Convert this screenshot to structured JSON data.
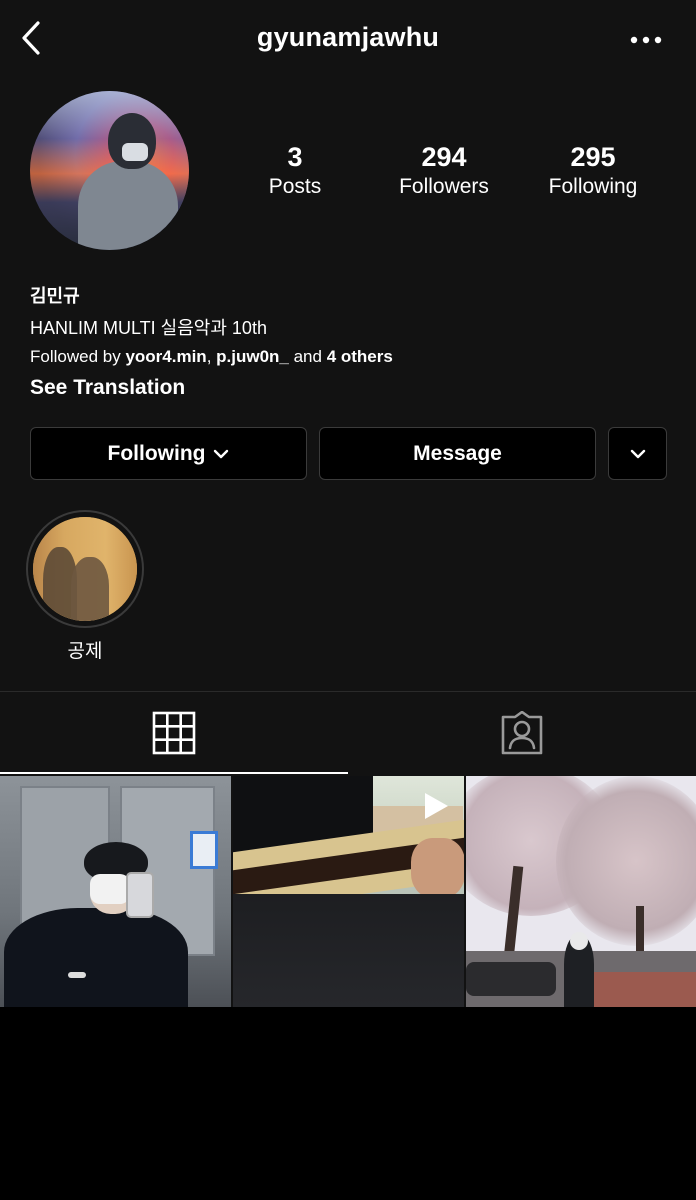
{
  "header": {
    "username": "gyunamjawhu",
    "back_icon": "chevron-left-icon",
    "more_icon": "more-horizontal-icon"
  },
  "stats": [
    {
      "value": "3",
      "label": "Posts"
    },
    {
      "value": "294",
      "label": "Followers"
    },
    {
      "value": "295",
      "label": "Following"
    }
  ],
  "bio": {
    "name": "김민규",
    "line": "HANLIM MULTI 실음악과 10th",
    "followed_by_prefix": "Followed by ",
    "follower1": "yoor4.min",
    "comma": ", ",
    "follower2": "p.juw0n_",
    "and": " and ",
    "others": "4 others",
    "see_translation": "See Translation"
  },
  "actions": {
    "following": "Following",
    "message": "Message"
  },
  "highlights": [
    {
      "label": "공제"
    }
  ],
  "tabs": {
    "grid_icon": "grid-icon",
    "tagged_icon": "tagged-person-icon",
    "active": "grid"
  },
  "posts": [
    {
      "kind": "photo"
    },
    {
      "kind": "video"
    },
    {
      "kind": "photo"
    }
  ],
  "colors": {
    "background": "#121212",
    "border": "#3b3b3b",
    "text": "#ffffff"
  }
}
